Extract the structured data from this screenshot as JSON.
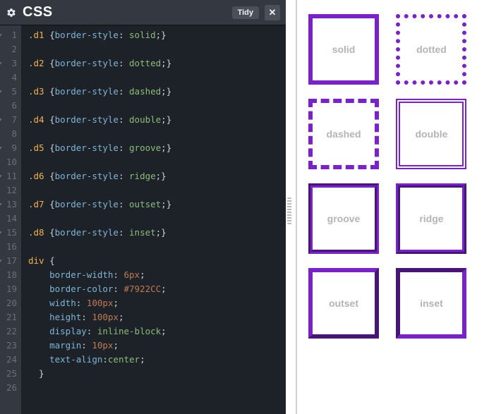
{
  "header": {
    "title": "CSS",
    "tidy_label": "Tidy",
    "close_label": "✕"
  },
  "code": {
    "lines": [
      {
        "n": "1",
        "fold": true,
        "sel": ".d1 ",
        "open": "{",
        "prop": "border-style",
        "val": "solid",
        "close": ";}"
      },
      {
        "n": "2",
        "blank": true
      },
      {
        "n": "3",
        "fold": true,
        "sel": ".d2 ",
        "open": "{",
        "prop": "border-style",
        "val": "dotted",
        "close": ";}"
      },
      {
        "n": "4",
        "blank": true
      },
      {
        "n": "5",
        "fold": true,
        "sel": ".d3 ",
        "open": "{",
        "prop": "border-style",
        "val": "dashed",
        "close": ";}"
      },
      {
        "n": "6",
        "blank": true
      },
      {
        "n": "7",
        "fold": true,
        "sel": ".d4 ",
        "open": "{",
        "prop": "border-style",
        "val": "double",
        "close": ";}"
      },
      {
        "n": "8",
        "blank": true
      },
      {
        "n": "9",
        "fold": true,
        "sel": ".d5 ",
        "open": "{",
        "prop": "border-style",
        "val": "groove",
        "close": ";}"
      },
      {
        "n": "10",
        "blank": true
      },
      {
        "n": "11",
        "fold": true,
        "sel": ".d6 ",
        "open": "{",
        "prop": "border-style",
        "val": "ridge",
        "close": ";}"
      },
      {
        "n": "12",
        "blank": true
      },
      {
        "n": "13",
        "fold": true,
        "sel": ".d7 ",
        "open": "{",
        "prop": "border-style",
        "val": "outset",
        "close": ";}"
      },
      {
        "n": "14",
        "blank": true
      },
      {
        "n": "15",
        "fold": true,
        "sel": ".d8 ",
        "open": "{",
        "prop": "border-style",
        "val": "inset",
        "close": ";}"
      },
      {
        "n": "16",
        "blank": true
      },
      {
        "n": "17",
        "fold": true,
        "sel": "div ",
        "open": "{"
      },
      {
        "n": "18",
        "indent": "    ",
        "prop": "border-width",
        "num": "6px",
        "term": ";"
      },
      {
        "n": "19",
        "indent": "    ",
        "prop": "border-color",
        "num": "#7922CC",
        "term": ";"
      },
      {
        "n": "20",
        "indent": "    ",
        "prop": "width",
        "num": "100px",
        "term": ";"
      },
      {
        "n": "21",
        "indent": "    ",
        "prop": "height",
        "num": "100px",
        "term": ";"
      },
      {
        "n": "22",
        "indent": "    ",
        "prop": "display",
        "val": "inline-block",
        "term": ";"
      },
      {
        "n": "23",
        "indent": "    ",
        "prop": "margin",
        "num": "10px",
        "term": ";"
      },
      {
        "n": "24",
        "indent": "    ",
        "prop": "text-align",
        "val": "center",
        "tight": true,
        "term": ";"
      },
      {
        "n": "25",
        "closebrace": "  }"
      },
      {
        "n": "26",
        "blank": true
      }
    ]
  },
  "preview": {
    "boxes": [
      {
        "cls": "d1",
        "label": "solid"
      },
      {
        "cls": "d2",
        "label": "dotted"
      },
      {
        "cls": "d3",
        "label": "dashed"
      },
      {
        "cls": "d4",
        "label": "double"
      },
      {
        "cls": "d5",
        "label": "groove"
      },
      {
        "cls": "d6",
        "label": "ridge"
      },
      {
        "cls": "d7",
        "label": "outset"
      },
      {
        "cls": "d8",
        "label": "inset"
      }
    ]
  }
}
